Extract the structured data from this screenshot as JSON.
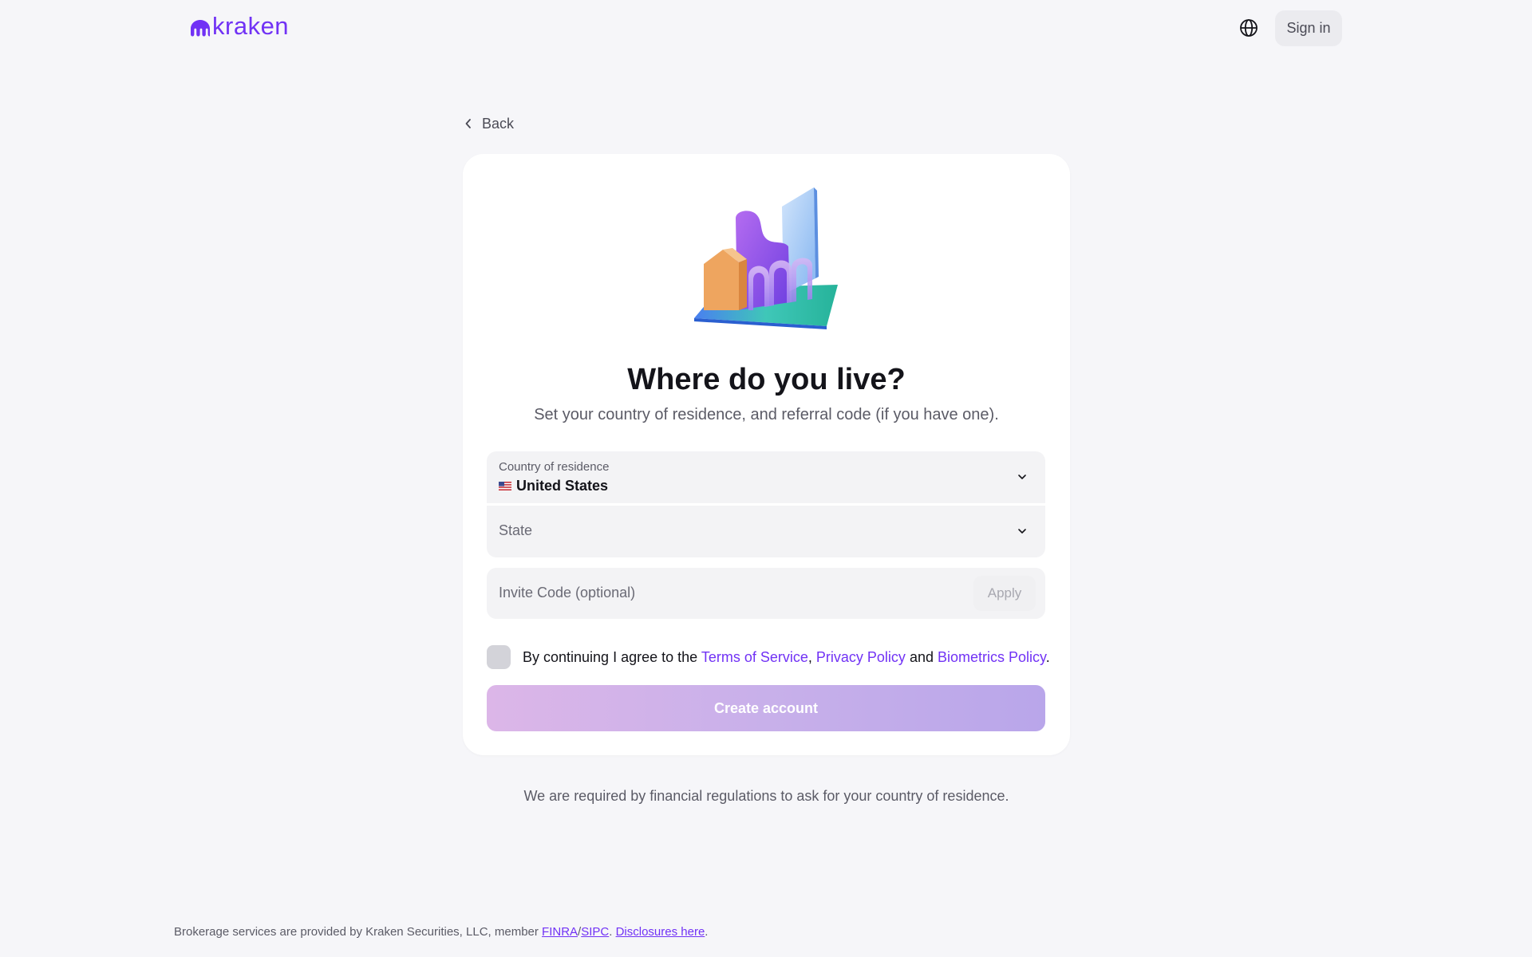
{
  "header": {
    "logo_text": "kraken",
    "brand_color": "#7132f5",
    "globe_icon": "globe-icon",
    "signin_label": "Sign in"
  },
  "back": {
    "label": "Back",
    "icon": "chevron-left-icon"
  },
  "card": {
    "illustration": "city-buildings-illustration",
    "title": "Where do you live?",
    "subtitle": "Set your country of residence, and referral code (if you have one).",
    "country": {
      "label": "Country of residence",
      "value": "United States",
      "flag": "us-flag-icon"
    },
    "state": {
      "placeholder": "State"
    },
    "invite": {
      "placeholder": "Invite Code (optional)",
      "apply_label": "Apply"
    },
    "consent": {
      "prefix": "By continuing I agree to the ",
      "terms": "Terms of Service",
      "sep": ",",
      "privacy": "Privacy Policy",
      "and": "and",
      "biometrics": "Biometrics Policy",
      "suffix": "."
    },
    "create_label": "Create account"
  },
  "notice": "We are required by financial regulations to ask for your country of residence.",
  "footer": {
    "prefix": "Brokerage services are provided by Kraken Securities, LLC, member ",
    "finra": "FINRA",
    "slash": "/",
    "sipc": "SIPC",
    "dot": ". ",
    "disclosures": "Disclosures here",
    "end": "."
  }
}
